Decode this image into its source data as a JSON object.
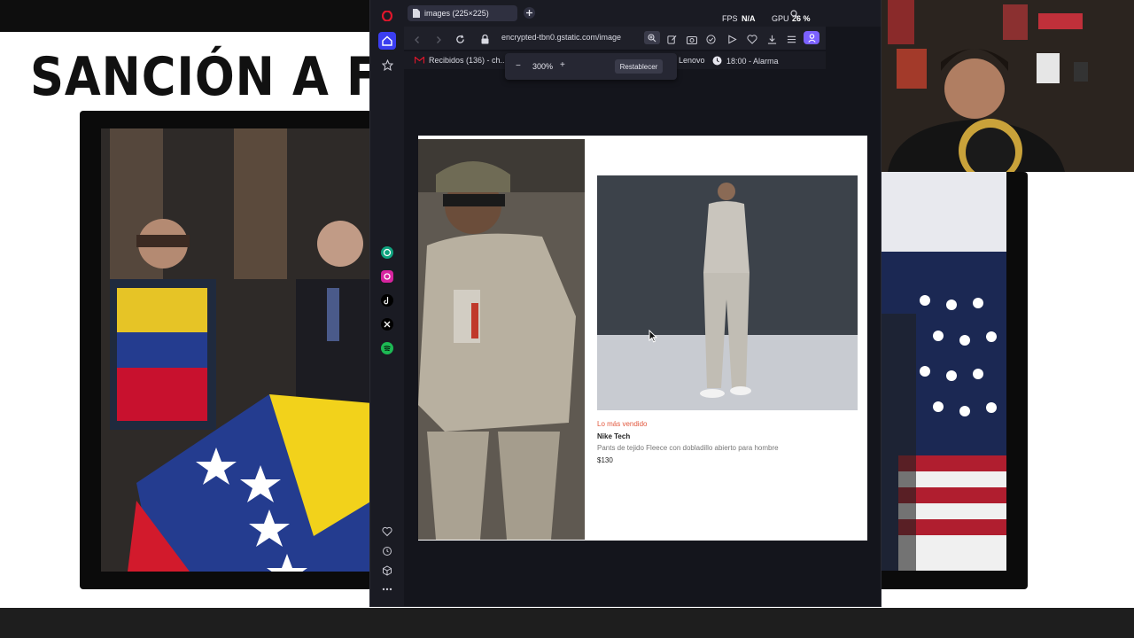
{
  "stream": {
    "slide_title": "SANCIÓN A FU"
  },
  "browser": {
    "tab_title": "images (225×225)",
    "fps_label": "FPS",
    "fps_value": "N/A",
    "gpu_label": "GPU",
    "gpu_value": "26 %",
    "url": "encrypted-tbn0.gstatic.com/image",
    "bookmarks": [
      "Recibidos (136) - ch...",
      "Lenovo",
      "18:00 - Alarma"
    ],
    "zoom": {
      "minus": "−",
      "value": "300%",
      "plus": "+",
      "reset_label": "Restablecer"
    },
    "product": {
      "tag": "Lo más vendido",
      "name": "Nike Tech",
      "description": "Pants de tejido Fleece con dobladillo abierto para hombre",
      "price": "$130"
    }
  },
  "colors": {
    "opera_red": "#e0162b",
    "accent_purple": "#7b61ff",
    "instagram": "#d6249f",
    "spotify": "#1db954",
    "chatgpt": "#10a37f",
    "tag_red": "#e2583e"
  }
}
